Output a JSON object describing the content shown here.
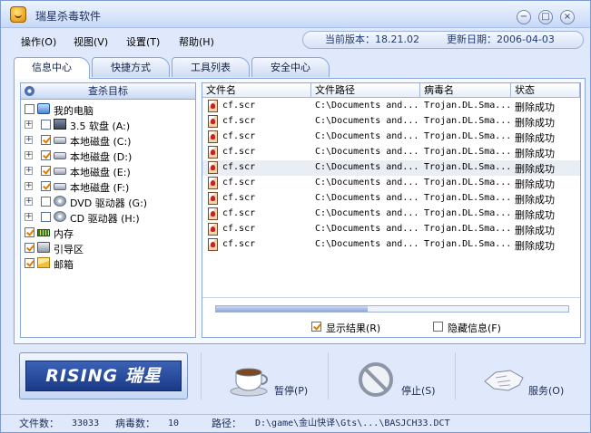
{
  "window": {
    "title": "瑞星杀毒软件",
    "minimize": "−",
    "restore": "□",
    "close": "×"
  },
  "menu": [
    "操作(O)",
    "视图(V)",
    "设置(T)",
    "帮助(H)"
  ],
  "version": {
    "label": "当前版本：18.21.02",
    "date": "更新日期：2006-04-03"
  },
  "tabs": [
    "信息中心",
    "快捷方式",
    "工具列表",
    "安全中心"
  ],
  "left": {
    "header": "查杀目标",
    "tree": [
      {
        "label": "我的电脑",
        "checked": false,
        "icon": "computer-icon"
      },
      {
        "label": "3.5 软盘 (A:)",
        "checked": false,
        "icon": "floppy-icon"
      },
      {
        "label": "本地磁盘 (C:)",
        "checked": true,
        "icon": "harddisk-icon"
      },
      {
        "label": "本地磁盘 (D:)",
        "checked": true,
        "icon": "harddisk-icon"
      },
      {
        "label": "本地磁盘 (E:)",
        "checked": true,
        "icon": "harddisk-icon"
      },
      {
        "label": "本地磁盘 (F:)",
        "checked": true,
        "icon": "harddisk-icon"
      },
      {
        "label": "DVD 驱动器 (G:)",
        "checked": false,
        "icon": "dvd-drive-icon"
      },
      {
        "label": "CD 驱动器 (H:)",
        "checked": false,
        "icon": "cd-drive-icon"
      },
      {
        "label": "内存",
        "checked": true,
        "icon": "memory-icon"
      },
      {
        "label": "引导区",
        "checked": true,
        "icon": "boot-sector-icon"
      },
      {
        "label": "邮箱",
        "checked": true,
        "icon": "mail-icon"
      }
    ]
  },
  "table": {
    "columns": [
      "文件名",
      "文件路径",
      "病毒名",
      "状态"
    ],
    "rows": [
      [
        "cf.scr",
        "C:\\Documents and...",
        "Trojan.DL.Sma...",
        "删除成功"
      ],
      [
        "cf.scr",
        "C:\\Documents and...",
        "Trojan.DL.Sma...",
        "删除成功"
      ],
      [
        "cf.scr",
        "C:\\Documents and...",
        "Trojan.DL.Sma...",
        "删除成功"
      ],
      [
        "cf.scr",
        "C:\\Documents and...",
        "Trojan.DL.Sma...",
        "删除成功"
      ],
      [
        "cf.scr",
        "C:\\Documents and...",
        "Trojan.DL.Sma...",
        "删除成功"
      ],
      [
        "cf.scr",
        "C:\\Documents and...",
        "Trojan.DL.Sma...",
        "删除成功"
      ],
      [
        "cf.scr",
        "C:\\Documents and...",
        "Trojan.DL.Sma...",
        "删除成功"
      ],
      [
        "cf.scr",
        "C:\\Documents and...",
        "Trojan.DL.Sma...",
        "删除成功"
      ],
      [
        "cf.scr",
        "C:\\Documents and...",
        "Trojan.DL.Sma...",
        "删除成功"
      ],
      [
        "cf.scr",
        "C:\\Documents and...",
        "Trojan.DL.Sma...",
        "删除成功"
      ]
    ],
    "selected_row": 4
  },
  "progress": 0.43,
  "options": {
    "show_results": {
      "label": "显示结果(R)",
      "checked": true
    },
    "hide_info": {
      "label": "隐藏信息(F)",
      "checked": false
    }
  },
  "brand": {
    "logo_text": "RISING 瑞星"
  },
  "buttons": {
    "pause": "暂停(P)",
    "stop": "停止(S)",
    "service": "服务(O)"
  },
  "status": {
    "files_label": "文件数：",
    "files_value": "33033",
    "virus_label": "病毒数：",
    "virus_value": "10",
    "path_label": "路径：",
    "path_value": "D:\\game\\金山快译\\Gts\\...\\BASJCH33.DCT"
  },
  "colors": {
    "accent": "#1a3a86",
    "check": "#e07b00",
    "virus": "#c62020"
  }
}
